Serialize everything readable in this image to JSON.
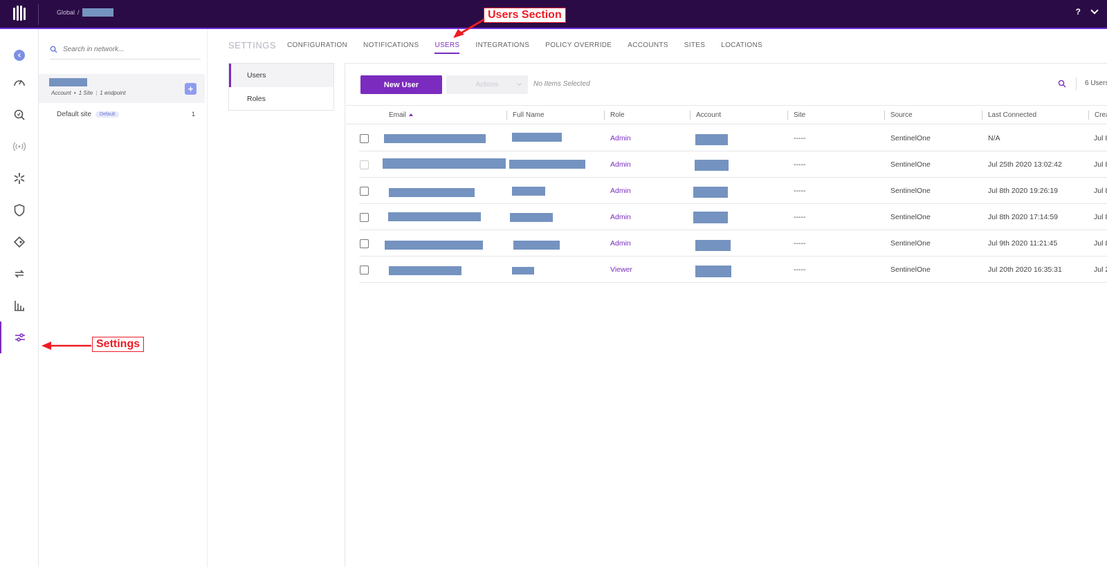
{
  "topbar": {
    "breadcrumb_root": "Global",
    "breadcrumb_sep": "/",
    "help_label": "?"
  },
  "tree": {
    "search_placeholder": "Search in network...",
    "account": {
      "type": "Account",
      "dot": "•",
      "sites": "1 Site",
      "sep": "|",
      "endpoints": "1 endpoint"
    },
    "site": {
      "name": "Default site",
      "badge": "Default",
      "count": "1"
    }
  },
  "settings": {
    "title": "SETTINGS",
    "tabs": [
      "CONFIGURATION",
      "NOTIFICATIONS",
      "USERS",
      "INTEGRATIONS",
      "POLICY OVERRIDE",
      "ACCOUNTS",
      "SITES",
      "LOCATIONS"
    ],
    "active_tab": "USERS",
    "subnav": [
      "Users",
      "Roles"
    ]
  },
  "users": {
    "new_user_label": "New User",
    "actions_label": "Actions",
    "no_items_label": "No Items Selected",
    "count_label": "6 Users",
    "columns": [
      "Email",
      "Full Name",
      "Role",
      "Account",
      "Site",
      "Source",
      "Last Connected",
      "Created"
    ],
    "rows": [
      {
        "role": "Admin",
        "site": "-----",
        "source": "SentinelOne",
        "last_connected": "N/A",
        "created": "Jul 8"
      },
      {
        "role": "Admin",
        "site": "-----",
        "source": "SentinelOne",
        "last_connected": "Jul 25th 2020 13:02:42",
        "created": "Jul 8"
      },
      {
        "role": "Admin",
        "site": "-----",
        "source": "SentinelOne",
        "last_connected": "Jul 8th 2020 19:26:19",
        "created": "Jul 8"
      },
      {
        "role": "Admin",
        "site": "-----",
        "source": "SentinelOne",
        "last_connected": "Jul 8th 2020 17:14:59",
        "created": "Jul 8"
      },
      {
        "role": "Admin",
        "site": "-----",
        "source": "SentinelOne",
        "last_connected": "Jul 9th 2020 11:21:45",
        "created": "Jul 8"
      },
      {
        "role": "Viewer",
        "site": "-----",
        "source": "SentinelOne",
        "last_connected": "Jul 20th 2020 16:35:31",
        "created": "Jul 2"
      }
    ]
  },
  "annotations": {
    "users_section": "Users Section",
    "settings": "Settings",
    "color": "#ee1c24"
  },
  "colors": {
    "brand": "#7b2cbf",
    "topbar": "#2b0b46",
    "redaction": "#7593c0"
  },
  "icons": [
    "sentinelone-logo-icon",
    "collapse-icon",
    "dashboard-icon",
    "threat-hunting-icon",
    "network-icon",
    "sentinels-icon",
    "shield-icon",
    "tag-icon",
    "sync-icon",
    "reports-icon",
    "settings-sliders-icon",
    "search-icon"
  ]
}
